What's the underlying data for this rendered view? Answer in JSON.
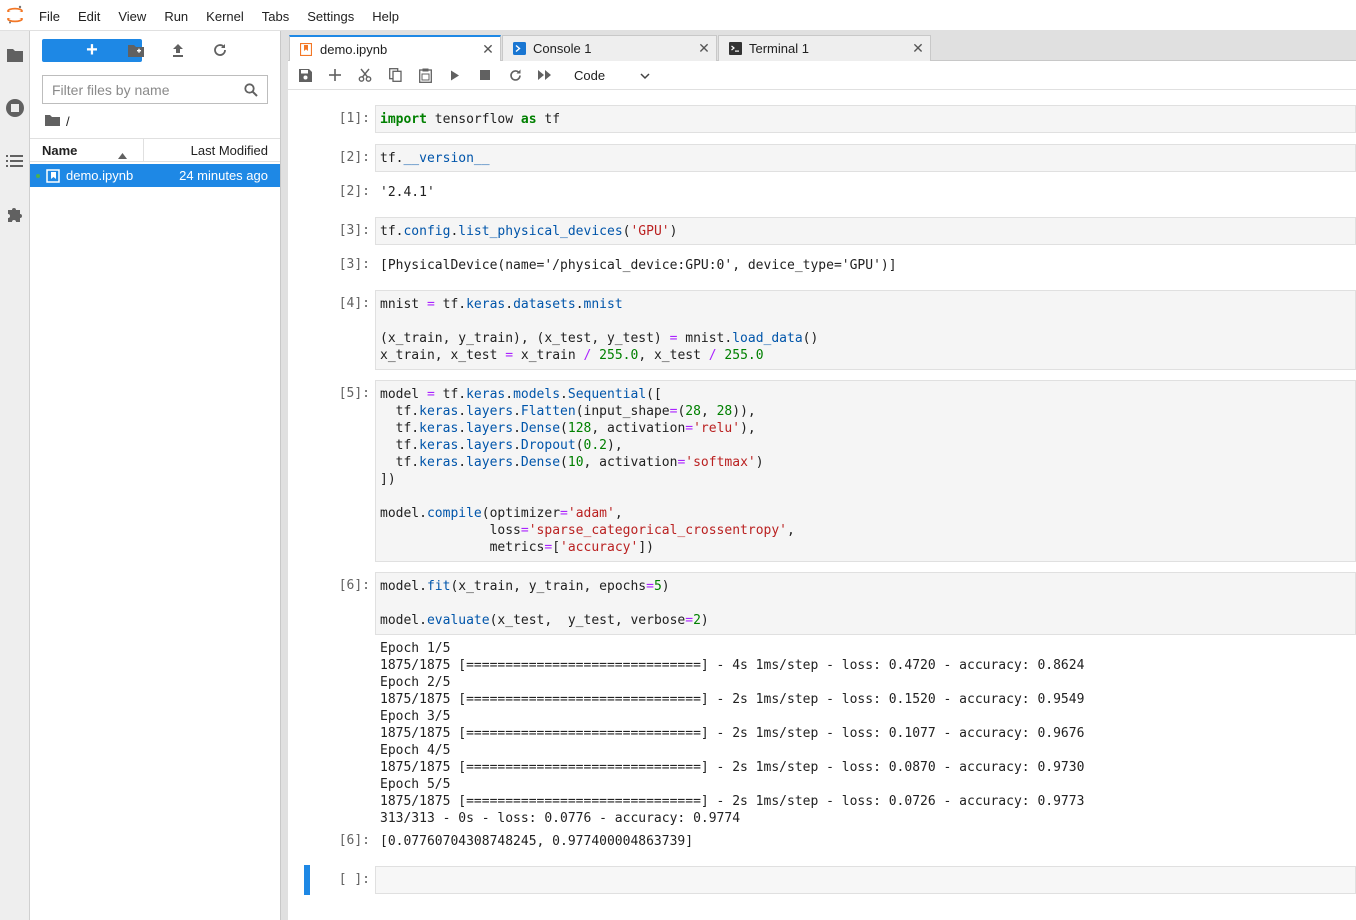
{
  "app": {
    "logo_icon": "jupyter-logo"
  },
  "menubar": {
    "items": [
      "File",
      "Edit",
      "View",
      "Run",
      "Kernel",
      "Tabs",
      "Settings",
      "Help"
    ]
  },
  "activity_bar": {
    "icons": [
      "folder-icon",
      "running-icon",
      "toc-icon",
      "extension-icon"
    ]
  },
  "filebrowser": {
    "new_button_label": "+",
    "search_placeholder": "Filter files by name",
    "breadcrumb": "/",
    "columns": {
      "name": "Name",
      "modified": "Last Modified"
    },
    "files": [
      {
        "name": "demo.ipynb",
        "modified": "24 minutes ago",
        "selected": true
      }
    ]
  },
  "tabs": [
    {
      "label": "demo.ipynb",
      "icon": "notebook-icon",
      "active": true
    },
    {
      "label": "Console 1",
      "icon": "console-icon",
      "active": false
    },
    {
      "label": "Terminal 1",
      "icon": "terminal-icon",
      "active": false
    }
  ],
  "toolbar": {
    "cell_type": "Code"
  },
  "cells": [
    {
      "in": "[1]:",
      "code": "import tensorflow as tf"
    },
    {
      "in": "[2]:",
      "code": "tf.__version__",
      "out_prompt": "[2]:",
      "output": "'2.4.1'"
    },
    {
      "in": "[3]:",
      "code": "tf.config.list_physical_devices('GPU')",
      "out_prompt": "[3]:",
      "output": "[PhysicalDevice(name='/physical_device:GPU:0', device_type='GPU')]"
    },
    {
      "in": "[4]:",
      "code": "mnist = tf.keras.datasets.mnist\n\n(x_train, y_train), (x_test, y_test) = mnist.load_data()\nx_train, x_test = x_train / 255.0, x_test / 255.0"
    },
    {
      "in": "[5]:",
      "code": "model = tf.keras.models.Sequential([\n  tf.keras.layers.Flatten(input_shape=(28, 28)),\n  tf.keras.layers.Dense(128, activation='relu'),\n  tf.keras.layers.Dropout(0.2),\n  tf.keras.layers.Dense(10, activation='softmax')\n])\n\nmodel.compile(optimizer='adam',\n              loss='sparse_categorical_crossentropy',\n              metrics=['accuracy'])"
    },
    {
      "in": "[6]:",
      "code": "model.fit(x_train, y_train, epochs=5)\n\nmodel.evaluate(x_test,  y_test, verbose=2)",
      "stream": "Epoch 1/5\n1875/1875 [==============================] - 4s 1ms/step - loss: 0.4720 - accuracy: 0.8624\nEpoch 2/5\n1875/1875 [==============================] - 2s 1ms/step - loss: 0.1520 - accuracy: 0.9549\nEpoch 3/5\n1875/1875 [==============================] - 2s 1ms/step - loss: 0.1077 - accuracy: 0.9676\nEpoch 4/5\n1875/1875 [==============================] - 2s 1ms/step - loss: 0.0870 - accuracy: 0.9730\nEpoch 5/5\n1875/1875 [==============================] - 2s 1ms/step - loss: 0.0726 - accuracy: 0.9773\n313/313 - 0s - loss: 0.0776 - accuracy: 0.9774",
      "out_prompt": "[6]:",
      "output": "[0.07760704308748245, 0.977400004863739]"
    },
    {
      "in": "[ ]:",
      "code": ""
    }
  ]
}
